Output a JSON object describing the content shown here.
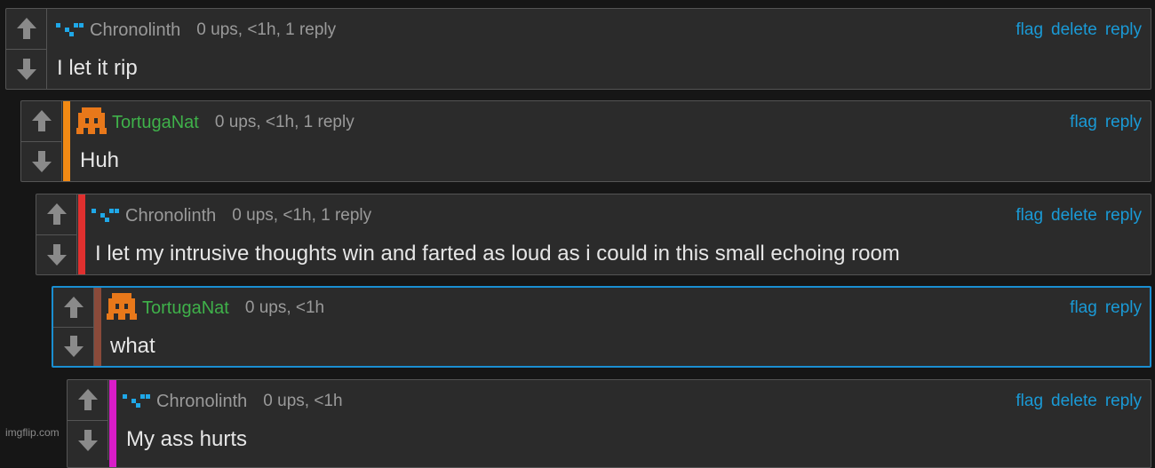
{
  "comments": [
    {
      "username": "Chronolinth",
      "meta": "0 ups, <1h, 1 reply",
      "text": "I let it rip",
      "actions": [
        "flag",
        "delete",
        "reply"
      ],
      "avatar": "chronolinth-pixel-icon",
      "bar_color": ""
    },
    {
      "username": "TortugaNat",
      "meta": "0 ups, <1h, 1 reply",
      "text": "Huh",
      "actions": [
        "flag",
        "reply"
      ],
      "avatar": "tortuganat-pixel-icon",
      "bar_color": "#f28a14"
    },
    {
      "username": "Chronolinth",
      "meta": "0 ups, <1h, 1 reply",
      "text": "I let my intrusive thoughts win and farted as loud as i could in this small echoing room",
      "actions": [
        "flag",
        "delete",
        "reply"
      ],
      "avatar": "chronolinth-pixel-icon",
      "bar_color": "#e0302f"
    },
    {
      "username": "TortugaNat",
      "meta": "0 ups, <1h",
      "text": "what",
      "actions": [
        "flag",
        "reply"
      ],
      "avatar": "tortuganat-pixel-icon",
      "bar_color": "#8a4a3a"
    },
    {
      "username": "Chronolinth",
      "meta": "0 ups, <1h",
      "text": "My ass hurts",
      "actions": [
        "flag",
        "delete",
        "reply"
      ],
      "avatar": "chronolinth-pixel-icon",
      "bar_color": "#d91cc8"
    }
  ],
  "watermark": "imgflip.com",
  "colors": {
    "accent_link": "#1a9ad6",
    "username_chronolinth": "#9a9a9a",
    "username_tortuganat": "#3fb14a",
    "highlight_border": "#1a8ed1"
  }
}
